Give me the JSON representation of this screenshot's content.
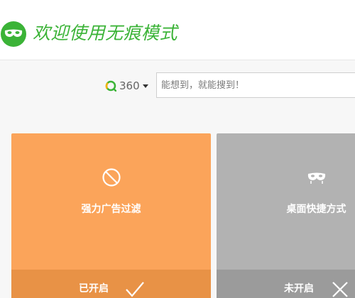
{
  "header": {
    "title": "欢迎使用无痕模式",
    "logo_icon": "mask-icon",
    "accent_color": "#3bb337"
  },
  "search": {
    "engine_label": "360",
    "engine_icon": "360-search-icon",
    "placeholder": "能想到，就能搜到！",
    "value": ""
  },
  "cards": [
    {
      "title": "强力广告过滤",
      "icon": "block-icon",
      "status": "已开启",
      "status_icon": "check-icon",
      "color": "#fba45a"
    },
    {
      "title": "桌面快捷方式",
      "icon": "mask-icon",
      "status": "未开启",
      "status_icon": "close-icon",
      "color": "#b2b2b2"
    }
  ]
}
